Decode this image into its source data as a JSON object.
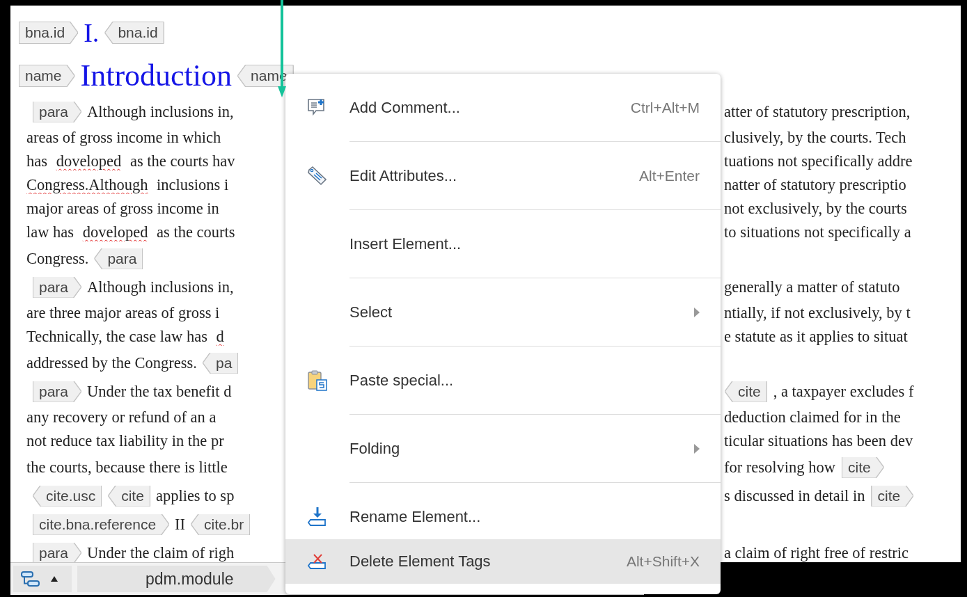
{
  "document": {
    "lines": [
      {
        "left": [
          {
            "kind": "start_tag",
            "text": "bna.id"
          },
          {
            "kind": "heading_number",
            "text": "I."
          },
          {
            "kind": "end_tag",
            "text": "bna.id"
          }
        ]
      },
      {
        "left": [
          {
            "kind": "start_tag",
            "text": "name"
          },
          {
            "kind": "heading_title",
            "text": "Introduction"
          },
          {
            "kind": "end_tag",
            "text": "name"
          }
        ]
      },
      {
        "left": [
          {
            "kind": "start_tag",
            "text": "para"
          },
          {
            "kind": "text",
            "text": "Although inclusions in,"
          }
        ],
        "right": [
          {
            "kind": "text",
            "text": "atter of statutory prescription,"
          }
        ]
      },
      {
        "left": [
          {
            "kind": "text",
            "text": "areas of gross income in which"
          }
        ],
        "right": [
          {
            "kind": "text",
            "text": "clusively, by the courts. Tech"
          }
        ]
      },
      {
        "left": [
          {
            "kind": "text",
            "text": "has "
          },
          {
            "kind": "misspelled",
            "text": "doveloped"
          },
          {
            "kind": "text",
            "text": " as the courts hav"
          }
        ],
        "right": [
          {
            "kind": "text",
            "text": "tuations not specifically addre"
          }
        ]
      },
      {
        "left": [
          {
            "kind": "misspelled",
            "text": "Congress.Although"
          },
          {
            "kind": "text",
            "text": " inclusions i"
          }
        ],
        "right": [
          {
            "kind": "text",
            "text": "natter of statutory prescriptio"
          }
        ]
      },
      {
        "left": [
          {
            "kind": "text",
            "text": "major areas of gross income in"
          }
        ],
        "right": [
          {
            "kind": "text",
            "text": "not exclusively, by the courts"
          }
        ]
      },
      {
        "left": [
          {
            "kind": "text",
            "text": "law has "
          },
          {
            "kind": "misspelled",
            "text": "doveloped"
          },
          {
            "kind": "text",
            "text": " as the courts"
          }
        ],
        "right": [
          {
            "kind": "text",
            "text": "to situations not specifically a"
          }
        ]
      },
      {
        "left": [
          {
            "kind": "text",
            "text": "Congress."
          },
          {
            "kind": "end_tag",
            "text": "para"
          }
        ]
      },
      {
        "left": [
          {
            "kind": "start_tag",
            "text": "para"
          },
          {
            "kind": "text",
            "text": "Although inclusions in,"
          }
        ],
        "right": [
          {
            "kind": "text",
            "text": "generally a matter of statuto"
          }
        ]
      },
      {
        "left": [
          {
            "kind": "text",
            "text": "are three major areas of gross i"
          }
        ],
        "right": [
          {
            "kind": "text",
            "text": "ntially, if not exclusively, by t"
          }
        ]
      },
      {
        "left": [
          {
            "kind": "text",
            "text": "Technically, the case law has "
          },
          {
            "kind": "misspelled",
            "text": "d"
          }
        ],
        "right": [
          {
            "kind": "text",
            "text": "e statute as it applies to situat"
          }
        ]
      },
      {
        "left": [
          {
            "kind": "text",
            "text": "addressed by the Congress."
          },
          {
            "kind": "end_tag",
            "text": "pa"
          }
        ]
      },
      {
        "left": [
          {
            "kind": "start_tag",
            "text": "para"
          },
          {
            "kind": "text",
            "text": "Under the tax benefit d"
          }
        ],
        "right": [
          {
            "kind": "end_tag",
            "text": "cite"
          },
          {
            "kind": "text",
            "text": ", a taxpayer excludes f"
          }
        ]
      },
      {
        "left": [
          {
            "kind": "text",
            "text": "any recovery or refund of an a"
          }
        ],
        "right": [
          {
            "kind": "text",
            "text": "deduction claimed for in the"
          }
        ]
      },
      {
        "left": [
          {
            "kind": "text",
            "text": "not reduce tax liability in the pr"
          }
        ],
        "right": [
          {
            "kind": "text",
            "text": "ticular situations has been dev"
          }
        ]
      },
      {
        "left": [
          {
            "kind": "text",
            "text": "the courts, because there is little"
          }
        ],
        "right": [
          {
            "kind": "text",
            "text": "for resolving how"
          },
          {
            "kind": "start_tag",
            "text": "cite"
          }
        ]
      },
      {
        "left": [
          {
            "kind": "end_tag",
            "text": "cite.usc"
          },
          {
            "kind": "end_tag",
            "text": "cite"
          },
          {
            "kind": "text",
            "text": "applies to sp"
          }
        ],
        "right": [
          {
            "kind": "text",
            "text": "s discussed in detail in"
          },
          {
            "kind": "start_tag",
            "text": "cite"
          }
        ]
      },
      {
        "left": [
          {
            "kind": "start_tag",
            "text": "cite.bna.reference"
          },
          {
            "kind": "text",
            "text": "II"
          },
          {
            "kind": "end_tag",
            "text": "cite.br"
          }
        ]
      },
      {
        "left": [
          {
            "kind": "start_tag",
            "text": "para"
          },
          {
            "kind": "text",
            "text": "Under the claim of righ"
          }
        ],
        "right": [
          {
            "kind": "text",
            "text": "a claim of right free of restric"
          }
        ]
      }
    ]
  },
  "status_bar": {
    "breadcrumb": [
      "pdm.module"
    ]
  },
  "context_menu": {
    "items": [
      {
        "label": "Add Comment...",
        "shortcut": "Ctrl+Alt+M",
        "kind": "comment",
        "submenu": false,
        "separator": true,
        "selected": false
      },
      {
        "label": "Edit Attributes...",
        "shortcut": "Alt+Enter",
        "kind": "tag",
        "submenu": false,
        "separator": true,
        "selected": false
      },
      {
        "label": "Insert Element...",
        "submenu": false,
        "separator": true,
        "selected": false
      },
      {
        "label": "Select",
        "submenu": true,
        "separator": true,
        "selected": false
      },
      {
        "label": "Paste special...",
        "kind": "paste",
        "submenu": false,
        "separator": true,
        "selected": false
      },
      {
        "label": "Folding",
        "submenu": true,
        "separator": true,
        "selected": false
      },
      {
        "label": "Rename Element...",
        "kind": "rename",
        "submenu": false,
        "separator": false,
        "selected": false
      },
      {
        "label": "Delete Element Tags",
        "shortcut": "Alt+Shift+X",
        "kind": "delete",
        "submenu": false,
        "separator": false,
        "selected": true
      }
    ]
  }
}
